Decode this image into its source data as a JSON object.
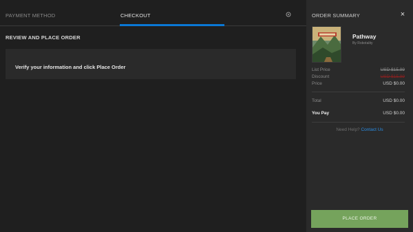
{
  "tabs": {
    "payment_method": "PAYMENT METHOD",
    "checkout": "CHECKOUT"
  },
  "review": {
    "title": "REVIEW AND PLACE ORDER",
    "verify_text": "Verify your information and click Place Order"
  },
  "summary": {
    "title": "ORDER SUMMARY",
    "close_label": "×",
    "product": {
      "name": "Pathway",
      "developer": "By Robotality"
    },
    "list_price_label": "List Price",
    "list_price_value": "USD $15.99",
    "discount_label": "Discount",
    "discount_value": "USD $15.99",
    "price_label": "Price",
    "price_value": "USD $0.00",
    "total_label": "Total",
    "total_value": "USD $0.00",
    "you_pay_label": "You Pay",
    "you_pay_value": "USD $0.00",
    "help_text": "Need Help?",
    "contact_label": "Contact Us",
    "place_order_label": "PLACE ORDER"
  },
  "colors": {
    "accent_blue": "#0a78d6",
    "button_green": "#75a35c",
    "discount_red": "#8a2020"
  }
}
